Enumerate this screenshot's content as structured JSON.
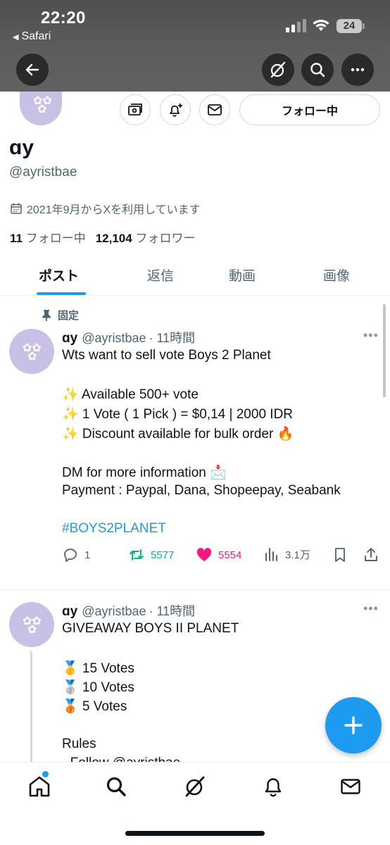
{
  "status_bar": {
    "time": "22:20",
    "back_app": "Safari",
    "battery": "24"
  },
  "profile": {
    "display_name": "ɑy",
    "handle": "@ayristbae",
    "joined": "2021年9月からXを利用しています",
    "following_count": "11",
    "following_label": "フォロー中",
    "followers_count": "12,104",
    "followers_label": "フォロワー",
    "follow_button": "フォロー中"
  },
  "tabs": [
    {
      "label": "ポスト",
      "active": true
    },
    {
      "label": "返信",
      "active": false
    },
    {
      "label": "動画",
      "active": false
    },
    {
      "label": "画像",
      "active": false
    }
  ],
  "posts": [
    {
      "pinned_label": "固定",
      "name": "ɑy",
      "handle": "@ayristbae",
      "time": "· 11時間",
      "lines": [
        "Wts want to sell vote Boys 2 Planet",
        "",
        "✨ Available 500+ vote",
        "✨ 1 Vote ( 1 Pick ) = $0,14 | 2000 IDR",
        "✨ Discount available for bulk order 🔥",
        "",
        "DM for more information 📩",
        "Payment : Paypal, Dana, Shopeepay, Seabank",
        "",
        "#BOYS2PLANET"
      ],
      "replies": "1",
      "reposts": "5577",
      "likes": "5554",
      "views": "3.1万"
    },
    {
      "name": "ɑy",
      "handle": "@ayristbae",
      "time": "· 11時間",
      "lines": [
        "GIVEAWAY BOYS II PLANET",
        "",
        "🥇 15 Votes",
        "🥈 10 Votes",
        "🥉 5 Votes",
        "",
        "Rules",
        "- Follow @ayristbae"
      ]
    }
  ],
  "colors": {
    "accent": "#1d9bf0",
    "repost": "#00ba7c",
    "like": "#f91880",
    "muted": "#536471",
    "avatar_bg": "#c9c0e6"
  },
  "icons": [
    "back-arrow-icon",
    "grok-icon",
    "search-icon",
    "more-icon",
    "tip-icon",
    "bell-plus-icon",
    "mail-icon",
    "calendar-icon",
    "pin-icon",
    "reply-icon",
    "repost-icon",
    "like-icon",
    "views-icon",
    "bookmark-icon",
    "share-icon",
    "compose-plus-icon",
    "home-icon"
  ]
}
